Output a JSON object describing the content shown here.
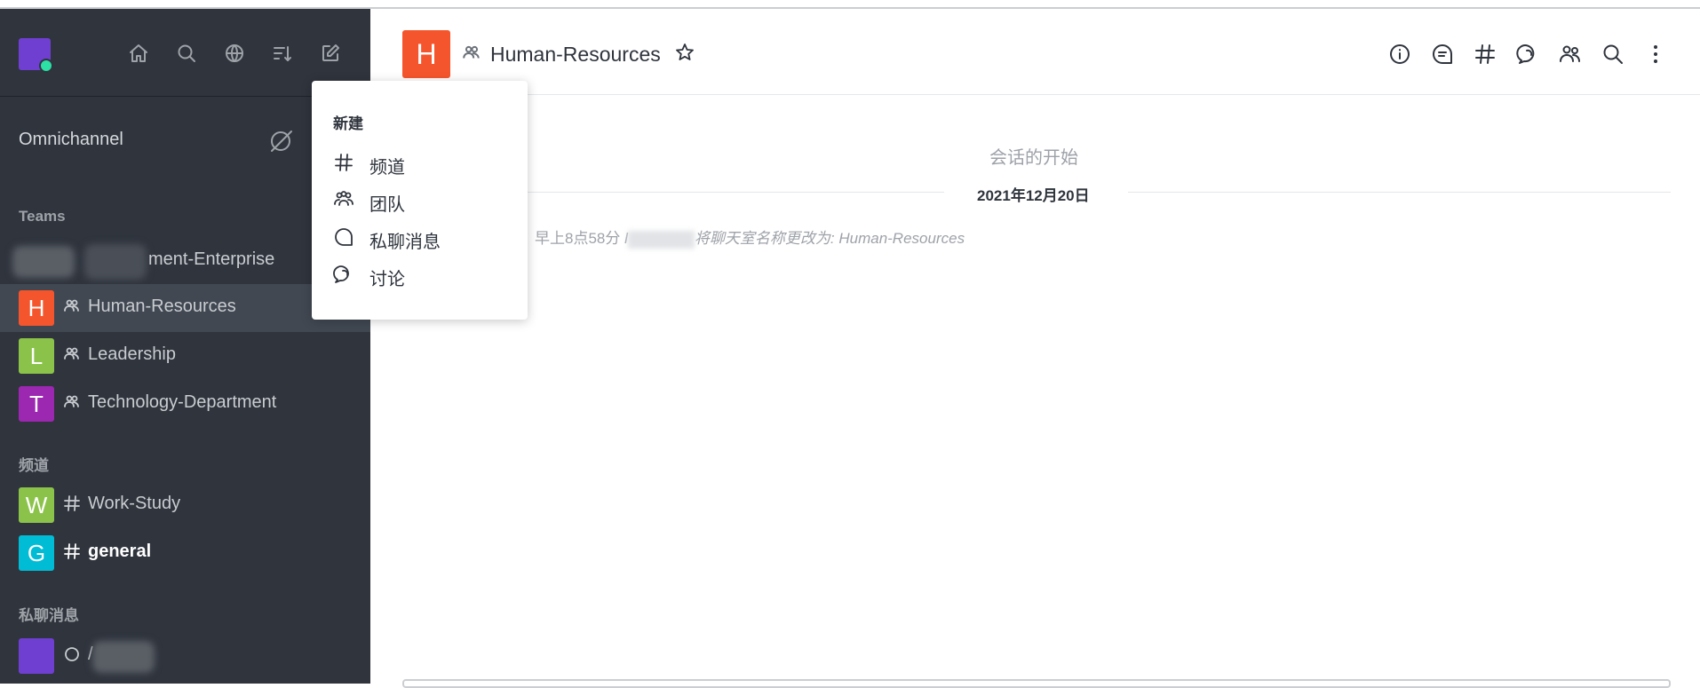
{
  "sidebar": {
    "omnichannel_label": "Omnichannel",
    "sections": {
      "teams": "Teams",
      "channels": "频道",
      "direct_messages": "私聊消息"
    },
    "teams": [
      {
        "initial": "",
        "name": "ment-Enterprise",
        "color": "#5a5f66",
        "icon": "team-icon"
      },
      {
        "initial": "H",
        "name": "Human-Resources",
        "color": "#f5552c",
        "icon": "team-icon",
        "active": true
      },
      {
        "initial": "L",
        "name": "Leadership",
        "color": "#8bc34a",
        "icon": "team-icon"
      },
      {
        "initial": "T",
        "name": "Technology-Department",
        "color": "#9c27b0",
        "icon": "team-icon"
      }
    ],
    "channels": [
      {
        "initial": "W",
        "name": "Work-Study",
        "color": "#8bc34a",
        "icon": "hash-icon"
      },
      {
        "initial": "G",
        "name": "general",
        "color": "#00bcd4",
        "icon": "hash-icon",
        "bold": true
      }
    ],
    "direct_messages": [
      {
        "initial": "",
        "name": "/",
        "color": "#6f3fd1",
        "icon": "status-offline-icon"
      }
    ]
  },
  "header": {
    "room_initial": "H",
    "room_title": "Human-Resources"
  },
  "messages": {
    "conversation_start": "会话的开始",
    "date": "2021年12月20日",
    "system_message": {
      "time": "早上8点58分",
      "user_fragment": "l",
      "text": "将聊天室名称更改为: ",
      "room_name": "Human-Resources"
    }
  },
  "dropdown": {
    "title": "新建",
    "items": [
      {
        "label": "频道",
        "icon": "hash-icon"
      },
      {
        "label": "团队",
        "icon": "team-icon"
      },
      {
        "label": "私聊消息",
        "icon": "direct-message-icon"
      },
      {
        "label": "讨论",
        "icon": "discussion-icon"
      }
    ]
  },
  "colors": {
    "sidebar_bg": "#2f343d",
    "active_room_bg": "#414852",
    "status_online": "#2de0a5",
    "user_avatar": "#6f3fd1"
  }
}
